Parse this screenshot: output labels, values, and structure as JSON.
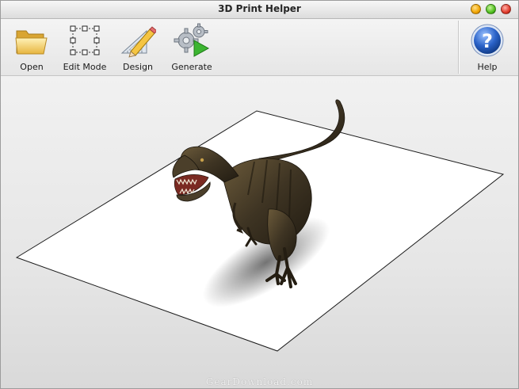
{
  "window": {
    "title": "3D Print Helper"
  },
  "toolbar": {
    "open_label": "Open",
    "edit_mode_label": "Edit Mode",
    "design_label": "Design",
    "generate_label": "Generate",
    "help_label": "Help"
  },
  "icons": {
    "open": "folder-icon",
    "edit_mode": "selection-grid-icon",
    "design": "pencil-ruler-icon",
    "generate": "gears-play-icon",
    "help": "question-icon"
  },
  "viewport": {
    "model": "t-rex-model",
    "watermark": "GearDownload.com"
  },
  "colors": {
    "window_bg": "#e8e8e8",
    "help_blue": "#2a62c8",
    "generate_green": "#3cb531"
  }
}
